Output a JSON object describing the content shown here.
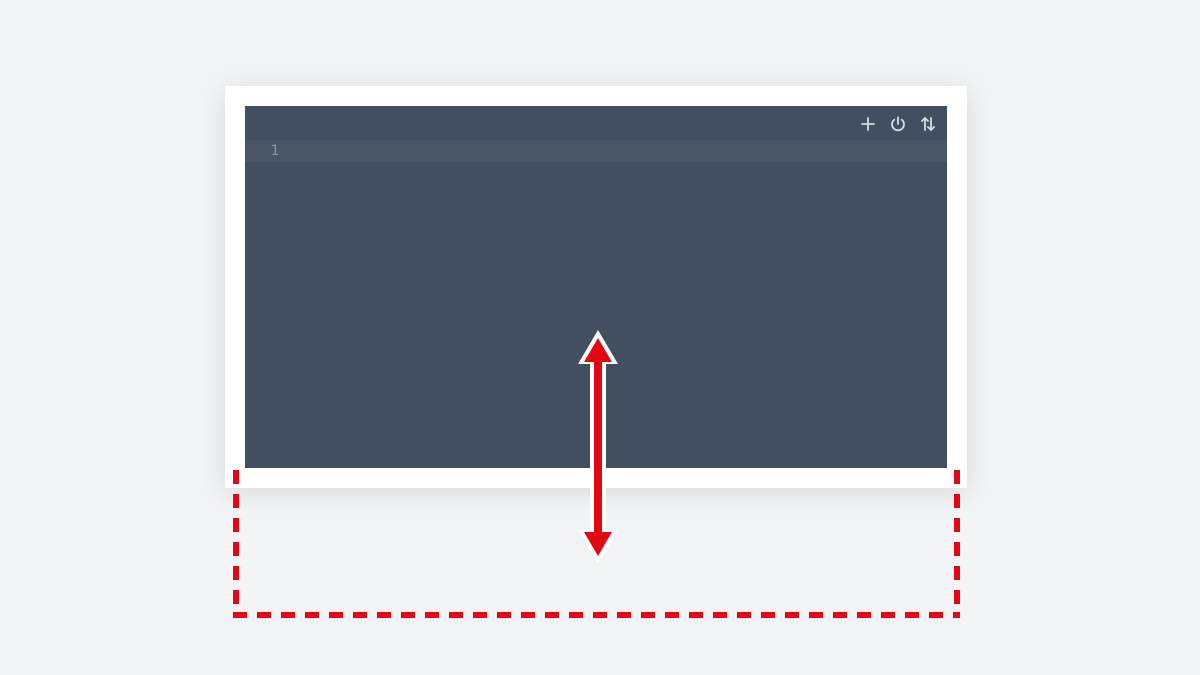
{
  "editor": {
    "line_number": "1",
    "content": "",
    "toolbar": {
      "add_label": "add",
      "power_label": "power",
      "sort_label": "sort"
    }
  },
  "overlay": {
    "resize_handle_name": "resize-vertical-handle",
    "drop_zone_name": "drop-zone-below"
  },
  "colors": {
    "editor_bg": "#424f60",
    "page_bg": "#f1f3f4",
    "accent_red": "#e30613",
    "icon_fg": "#d7dce1"
  }
}
